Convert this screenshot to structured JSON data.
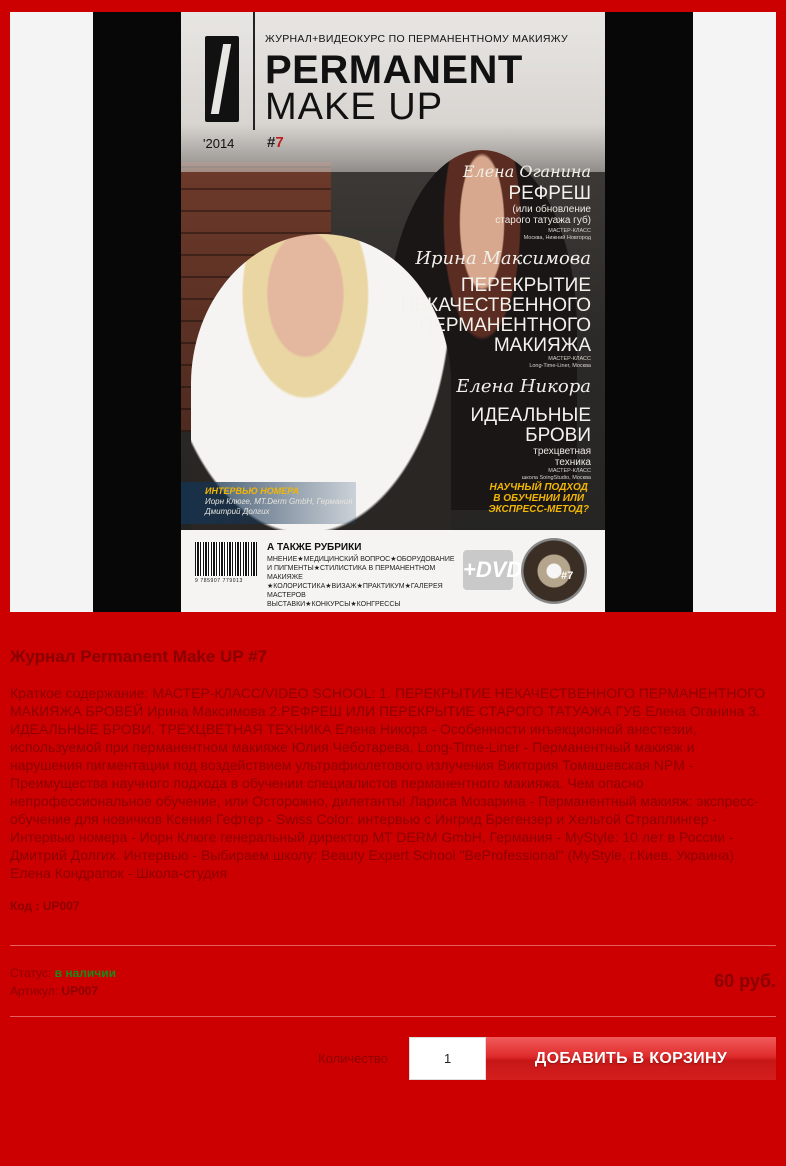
{
  "cover": {
    "tagline": "ЖУРНАЛ+ВИДЕОКУРС ПО ПЕРМАНЕНТНОМУ МАКИЯЖУ",
    "title": "PERMANENT",
    "subtitle": "MAKE UP",
    "year": "'2014",
    "issue_prefix": "#",
    "issue_number": "7",
    "feature1_name": "Елена Оганина",
    "feature1_head": "РЕФРЕШ",
    "feature1_sub": "(или обновление\nстарого татуажа губ)",
    "feature1_tiny": "МАСТЕР-КЛАСС\nМосква, Нижний Новгород",
    "feature2_name": "Ирина Максимова",
    "feature2_head": "ПЕРЕКРЫТИЕ\nНЕКАЧЕСТВЕННОГО\nПЕРМАНЕНТНОГО\nМАКИЯЖА",
    "feature2_tiny": "МАСТЕР-КЛАСС\nLong-Time-Liner, Москва",
    "feature3_name": "Елена Никора",
    "feature3_head": "ИДЕАЛЬНЫЕ\nБРОВИ",
    "feature3_sub": "трехцветная\nтехника",
    "feature3_tiny": "МАСТЕР-КЛАСС\nшкола SoingStudio, Москва",
    "approach": "НАУЧНЫЙ ПОДХОД\nВ ОБУЧЕНИИ ИЛИ\nЭКСПРЕСС-МЕТОД?",
    "interview_title": "ИНТЕРВЬЮ НОМЕРА",
    "interview_names": "Иорн Клюге, MT.Derm GmbH, Германия\nДмитрий Долгих",
    "rubrics_title": "А ТАКЖЕ РУБРИКИ",
    "rubrics_list": "МНЕНИЕ★МЕДИЦИНСКИЙ ВОПРОС★ОБОРУДОВАНИЕ\nИ ПИГМЕНТЫ★СТИЛИСТИКА В ПЕРМАНЕНТНОМ МАКИЯЖЕ\n★КОЛОРИСТИКА★ВИЗАЖ★ПРАКТИКУМ★ГАЛЕРЕЯ МАСТЕРОВ\nВЫСТАВКИ★КОНКУРСЫ★КОНГРЕССЫ",
    "barcode_number": "9 785907 779013",
    "dvd_label": "+DVD",
    "dvd_issue": "#7"
  },
  "product": {
    "title": "Журнал Permanent Make UP #7",
    "description": "Краткое содержание: МАСТЕР-КЛАСС/VIDEO SCHOOL: 1. ПЕРЕКРЫТИЕ НЕКАЧЕСТВЕННОГО ПЕРМАНЕНТНОГО МАКИЯЖА БРОВЕЙ Ирина Максимова 2.РЕФРЕШ ИЛИ ПЕРЕКРЫТИЕ СТАРОГО ТАТУАЖА ГУБ Елена Оганина 3. ИДЕАЛЬНЫЕ БРОВИ. ТРЕХЦВЕТНАЯ ТЕХНИКА Елена Никора - Особенности инъекционной анестезии, используемой при перманентном макияже Юлия Чеботарева, Long-Time-Liner - Перманентный макияж и нарушения пигментации под воздействием ультрафиолетового излучения Виктория Томашевская NPM - Преимущества научного подхода в обучении специалистов перманентного макияжа. Чем опасно непрофессиональное обучение, или Осторожно, дилетанты! Лариса Мозарина - Перманентный макияж: экспресс-обучение для новичков Ксения Гефтер - Swiss Color: интервью с Ингрид Брегензер и Хельтой Страплингер - Интервью номера - Иорн Клюге генеральный директор MT DERM GmbH, Германия - MyStyle: 10 лет в России - Дмитрий Долгих. Интервью - Выбираем школу: Beauty Expert School \"BeProfessional\" (MyStyle, г.Киев, Украина) Елена Кондрапок - Школа-студия",
    "code_label": "Код :",
    "code_value": "UP007",
    "status_label": "Статус:",
    "status_value": "в наличии",
    "article_label": "Артикул:",
    "article_value": "UP007",
    "price": "60 руб.",
    "quantity_label": "Количество",
    "quantity_value": "1",
    "add_to_cart": "ДОБАВИТЬ В КОРЗИНУ"
  },
  "colors": {
    "background": "#cc0000",
    "text": "#8d0000",
    "in_stock": "#1a8a1a",
    "button": "#e02c2c"
  }
}
